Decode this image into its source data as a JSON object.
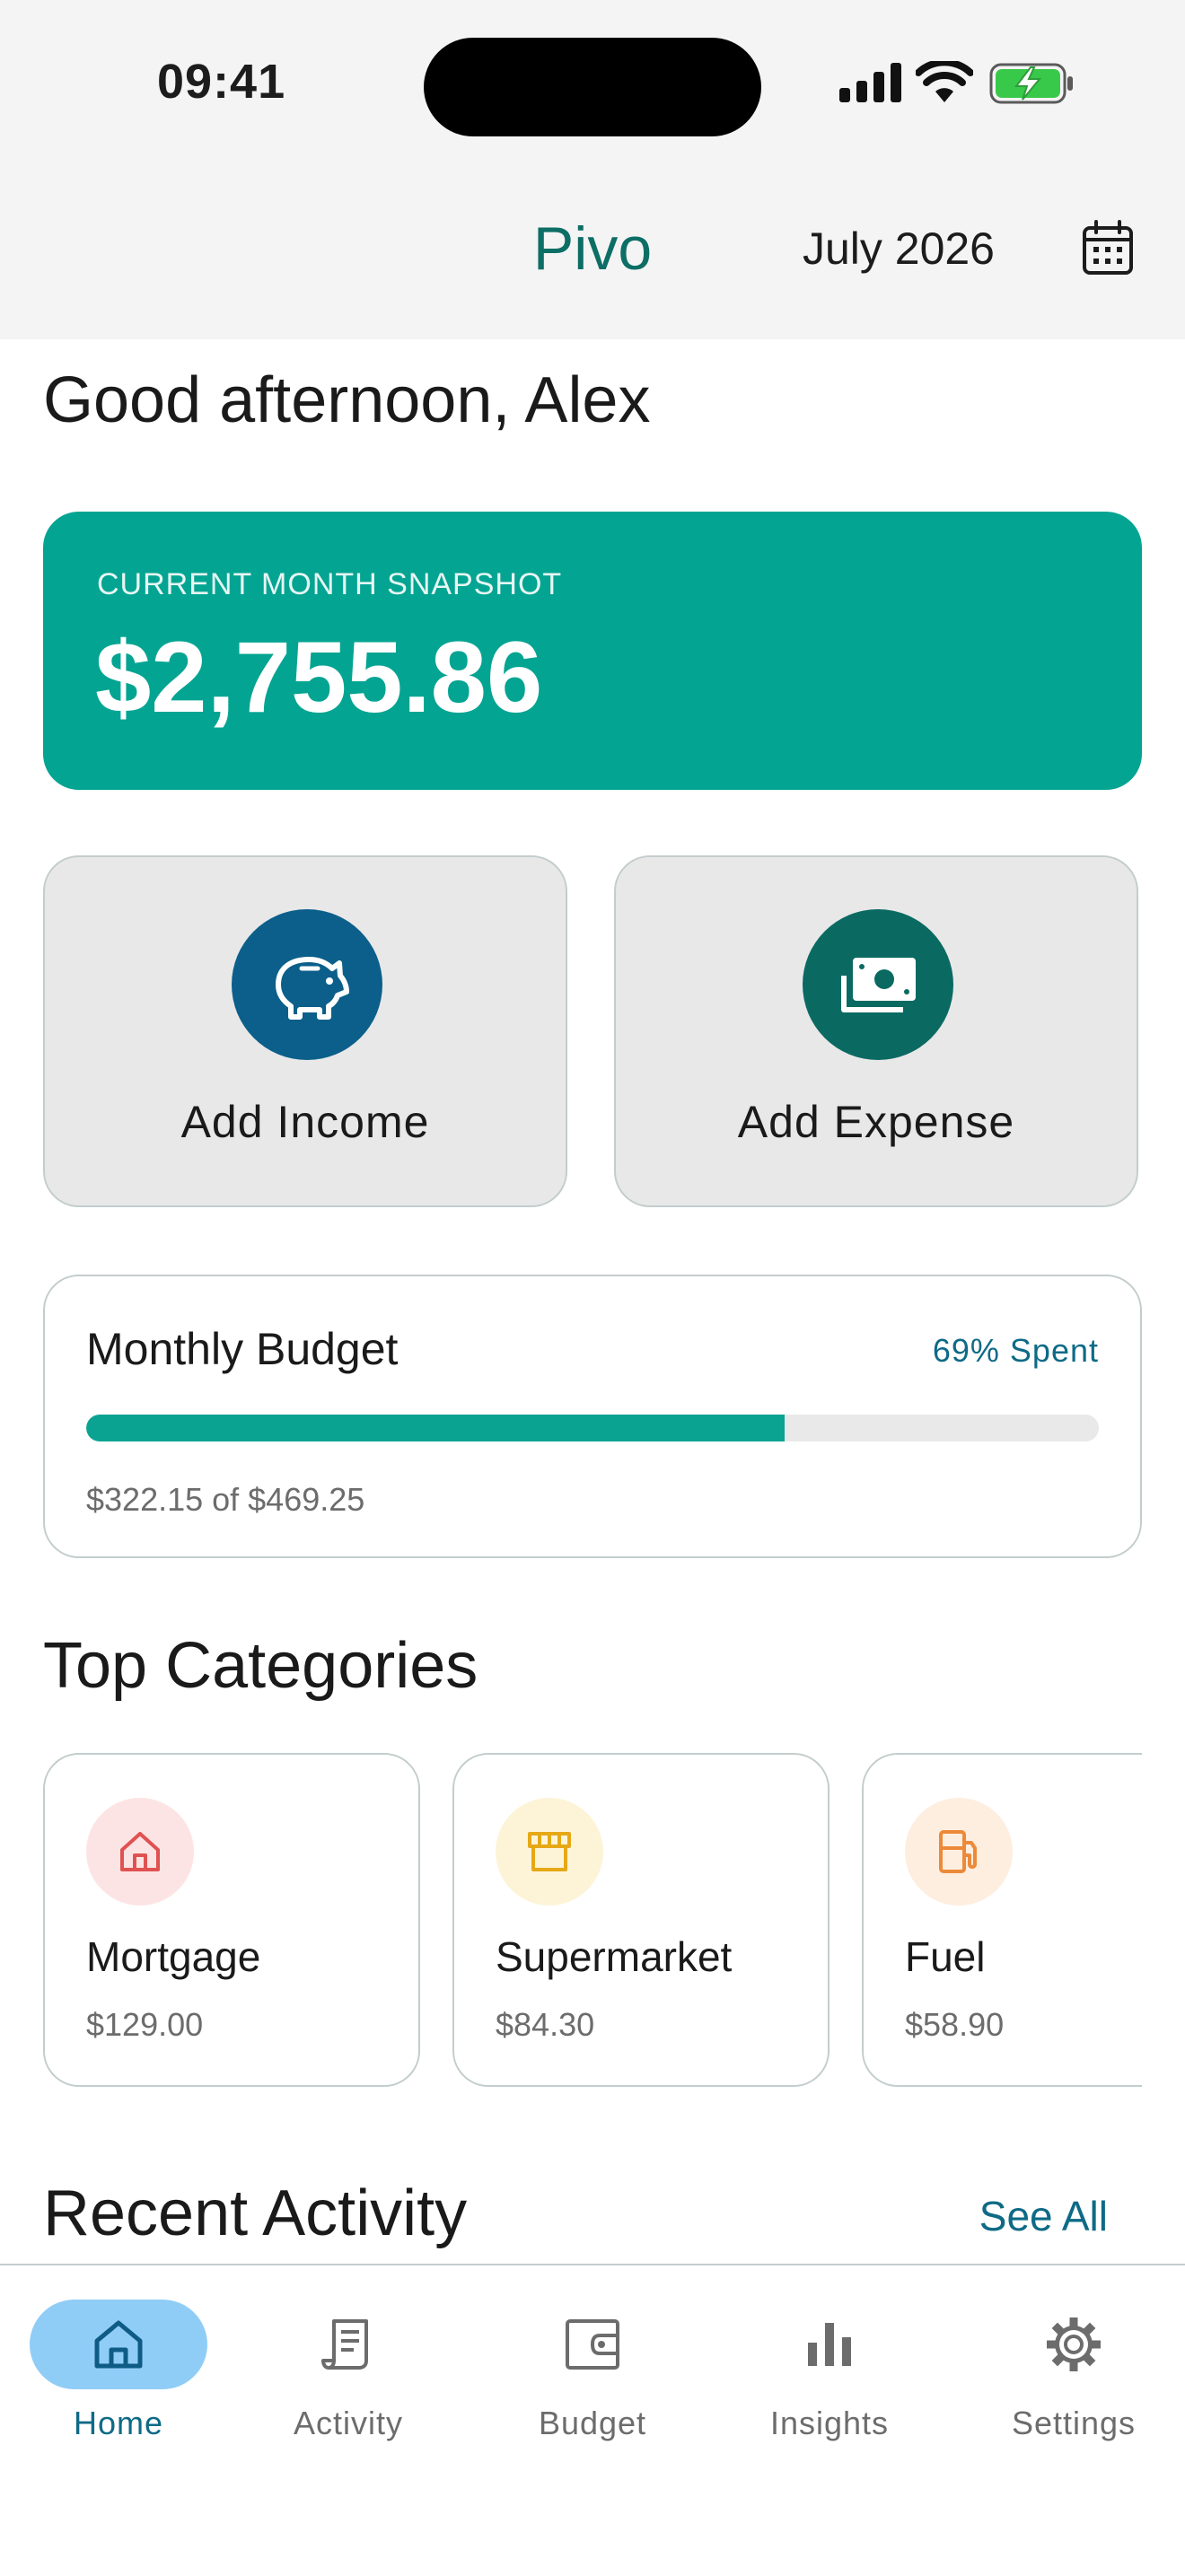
{
  "status_bar": {
    "time": "09:41"
  },
  "header": {
    "app_title": "Pivo",
    "month": "July 2026",
    "calendar_icon": "calendar-icon"
  },
  "greeting": "Good afternoon, Alex",
  "snapshot": {
    "label": "CURRENT MONTH SNAPSHOT",
    "value": "$2,755.86"
  },
  "actions": [
    {
      "label": "Add Income",
      "icon": "piggy-bank-icon",
      "color": "#0b5f8a"
    },
    {
      "label": "Add Expense",
      "icon": "cash-icon",
      "color": "#0a6a62"
    }
  ],
  "budget": {
    "title": "Monthly Budget",
    "pct_label": "69% Spent",
    "progress": 0.69,
    "amount": "$322.15 of $469.25"
  },
  "top_categories": {
    "title": "Top Categories",
    "items": [
      {
        "name": "Mortgage",
        "amount": "$129.00",
        "icon": "house-icon",
        "bg": "#fde4e4",
        "color": "#e05252"
      },
      {
        "name": "Supermarket",
        "amount": "$84.30",
        "icon": "store-icon",
        "bg": "#fdf4d8",
        "color": "#e6a817"
      },
      {
        "name": "Fuel",
        "amount": "$58.90",
        "icon": "fuel-pump-icon",
        "bg": "#fdeee0",
        "color": "#ec8a3a"
      }
    ]
  },
  "recent": {
    "title": "Recent Activity",
    "see_all": "See All"
  },
  "tabs": [
    {
      "label": "Home",
      "icon": "home-icon",
      "active": true
    },
    {
      "label": "Activity",
      "icon": "receipt-icon",
      "active": false
    },
    {
      "label": "Budget",
      "icon": "wallet-icon",
      "active": false
    },
    {
      "label": "Insights",
      "icon": "bar-chart-icon",
      "active": false
    },
    {
      "label": "Settings",
      "icon": "gear-icon",
      "active": false
    }
  ]
}
